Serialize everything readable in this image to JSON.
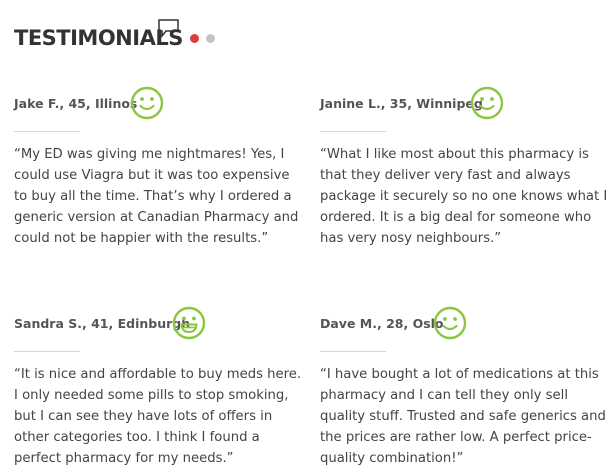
{
  "section": {
    "title": "TESTIMONIALS",
    "icon": "speech-bubble-icon",
    "pager": {
      "count": 2,
      "active_index": 0,
      "active_color": "#e03a3e",
      "inactive_color": "#c4c4c4"
    }
  },
  "smiley_color": "#8cc63f",
  "testimonials": [
    {
      "name": "Jake F., 45, Illinos",
      "icon": "smiley-icon",
      "quote": "“My ED was giving me nightmares! Yes, I could use Viagra but it was too expensive to buy all the time. That’s why I ordered a generic version at Canadian Pharmacy and could not be happier with the results.”"
    },
    {
      "name": "Janine L., 35, Winnipeg",
      "icon": "smiley-icon",
      "quote": "“What I like most about this pharmacy is that they deliver very fast and always package it securely so no one knows what I ordered. It is a big deal for someone who has very nosy neighbours.”"
    },
    {
      "name": "Sandra S., 41, Edinburgh",
      "icon": "grin-icon",
      "quote": "“It is nice and affordable to buy meds here. I only needed some pills to stop smoking, but I can see they have lots of offers in other categories too. I think I found a perfect pharmacy for my needs.”"
    },
    {
      "name": "Dave M., 28, Oslo",
      "icon": "smiley-icon",
      "quote": "“I have bought a lot of medications at this pharmacy and I can tell they only sell quality stuff. Trusted and safe generics and the prices are rather low. A perfect price-quality combination!”"
    }
  ]
}
